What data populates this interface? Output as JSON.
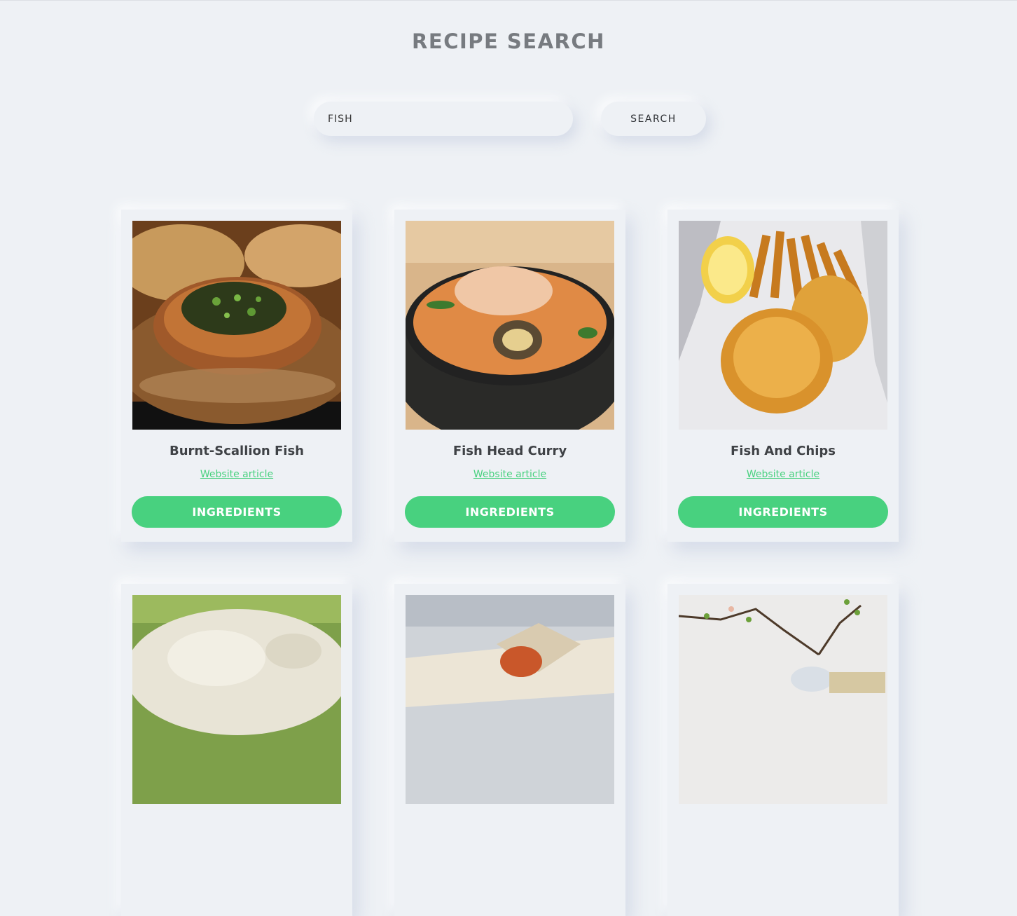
{
  "header": {
    "title": "RECIPE SEARCH"
  },
  "search": {
    "value": "FISH",
    "button_label": "SEARCH"
  },
  "colors": {
    "accent": "#48d17f",
    "background": "#eef1f5",
    "title": "#777b80"
  },
  "recipes": [
    {
      "title": "Burnt-Scallion Fish",
      "link_label": "Website article",
      "button_label": "INGREDIENTS",
      "image_icon": "scallion-fish-photo"
    },
    {
      "title": "Fish Head Curry",
      "link_label": "Website article",
      "button_label": "INGREDIENTS",
      "image_icon": "fish-curry-photo"
    },
    {
      "title": "Fish And Chips",
      "link_label": "Website article",
      "button_label": "INGREDIENTS",
      "image_icon": "fish-and-chips-photo"
    },
    {
      "image_icon": "white-fish-photo"
    },
    {
      "image_icon": "fish-sandwich-photo"
    },
    {
      "image_icon": "branch-vase-photo"
    }
  ]
}
